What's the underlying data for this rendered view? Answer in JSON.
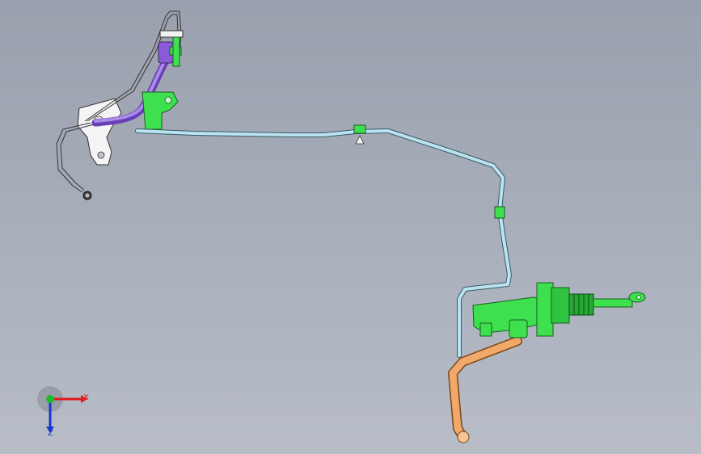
{
  "viewport": {
    "background_top": "#9aa0ad",
    "background_bottom": "#b8bdc7"
  },
  "model": {
    "part_colors": {
      "tube": "#b9e3f0",
      "tube_outline": "#3c5a66",
      "green_part": "#3fe04f",
      "purple_hose": "#8b5ad8",
      "orange_pipe": "#f0a96a",
      "bracket": "#f4f4f4"
    }
  },
  "triad": {
    "x_label": "X",
    "z_label": "Z",
    "x_color": "#e11b1b",
    "y_color": "#1bbf2a",
    "z_color": "#1b36c9"
  }
}
